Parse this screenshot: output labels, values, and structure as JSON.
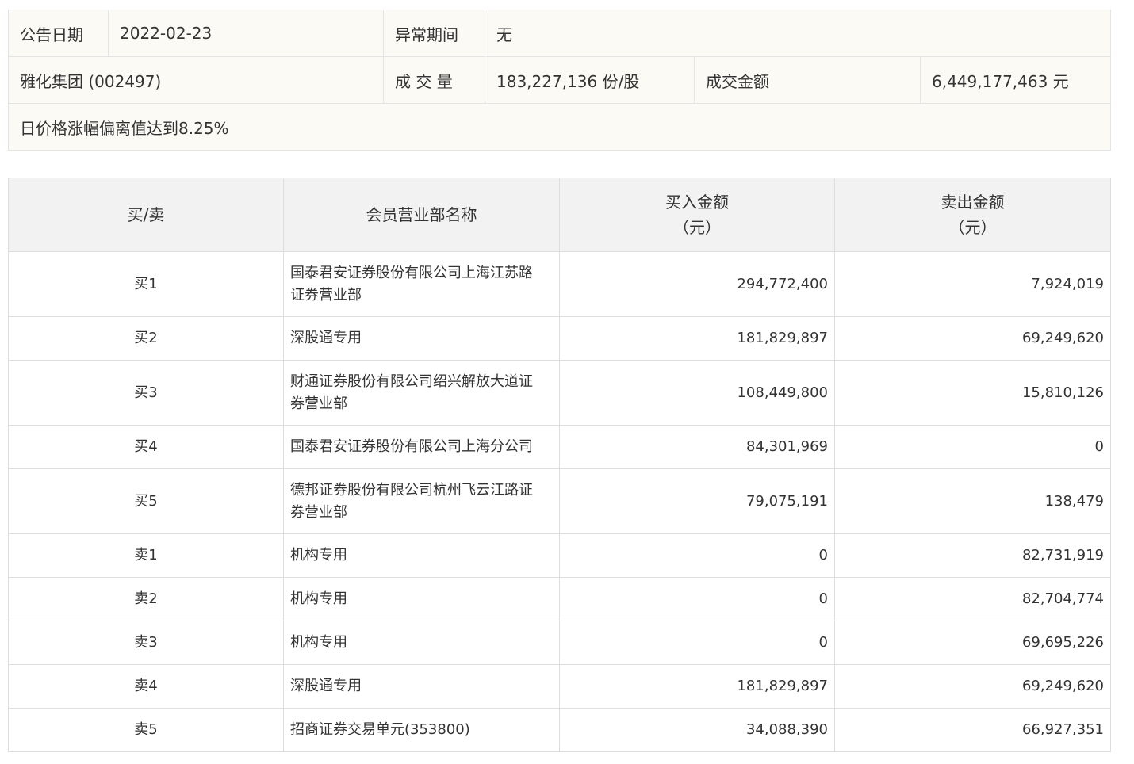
{
  "info": {
    "date_label": "公告日期",
    "date_value": "2022-02-23",
    "abnormal_label": "异常期间",
    "abnormal_value": "无",
    "stock_name": "雅化集团 (002497)",
    "volume_label": "成 交 量",
    "volume_value": "183,227,136 份/股",
    "amount_label": "成交金额",
    "amount_value": "6,449,177,463 元",
    "reason": "日价格涨幅偏离值达到8.25%"
  },
  "table": {
    "headers": {
      "side": "买/卖",
      "member": "会员营业部名称",
      "buy_line1": "买入金额",
      "buy_line2": "（元）",
      "sell_line1": "卖出金额",
      "sell_line2": "（元）"
    },
    "rows": [
      {
        "side": "买1",
        "member_line1": "国泰君安证券股份有限公司上海江苏路",
        "member_line2": "证券营业部",
        "buy": "294,772,400",
        "sell": "7,924,019"
      },
      {
        "side": "买2",
        "member_line1": "深股通专用",
        "member_line2": "",
        "buy": "181,829,897",
        "sell": "69,249,620"
      },
      {
        "side": "买3",
        "member_line1": "财通证券股份有限公司绍兴解放大道证",
        "member_line2": "券营业部",
        "buy": "108,449,800",
        "sell": "15,810,126"
      },
      {
        "side": "买4",
        "member_line1": "国泰君安证券股份有限公司上海分公司",
        "member_line2": "",
        "buy": "84,301,969",
        "sell": "0"
      },
      {
        "side": "买5",
        "member_line1": "德邦证券股份有限公司杭州飞云江路证",
        "member_line2": "券营业部",
        "buy": "79,075,191",
        "sell": "138,479"
      },
      {
        "side": "卖1",
        "member_line1": "机构专用",
        "member_line2": "",
        "buy": "0",
        "sell": "82,731,919"
      },
      {
        "side": "卖2",
        "member_line1": "机构专用",
        "member_line2": "",
        "buy": "0",
        "sell": "82,704,774"
      },
      {
        "side": "卖3",
        "member_line1": "机构专用",
        "member_line2": "",
        "buy": "0",
        "sell": "69,695,226"
      },
      {
        "side": "卖4",
        "member_line1": "深股通专用",
        "member_line2": "",
        "buy": "181,829,897",
        "sell": "69,249,620"
      },
      {
        "side": "卖5",
        "member_line1": "招商证券交易单元(353800)",
        "member_line2": "",
        "buy": "34,088,390",
        "sell": "66,927,351"
      }
    ]
  }
}
